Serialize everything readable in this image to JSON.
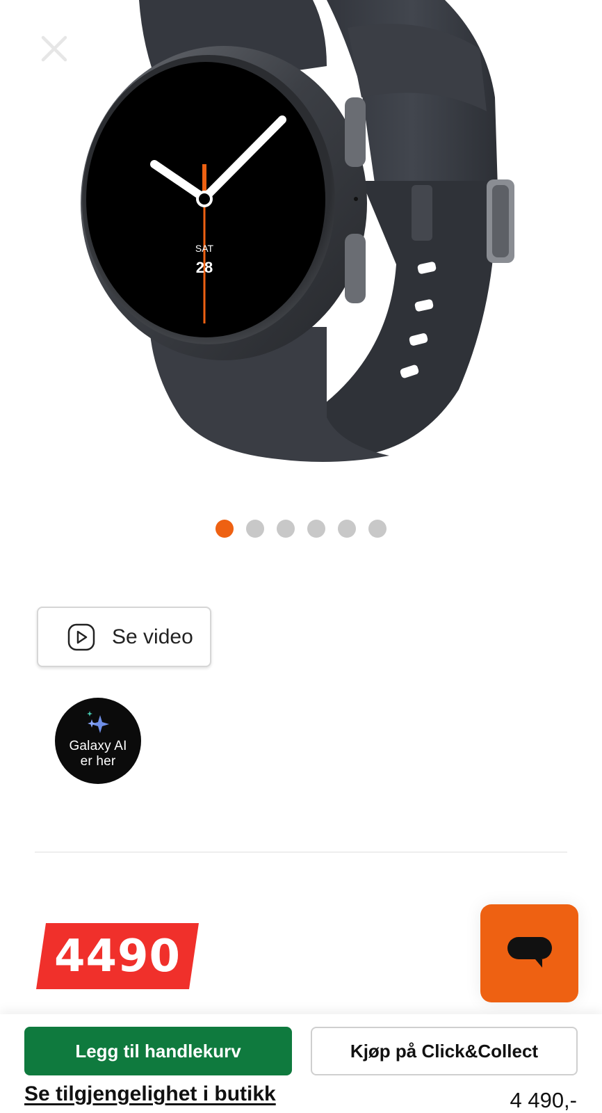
{
  "product": {
    "image_alt": "Samsung Galaxy Watch",
    "watch_face": {
      "day": "SAT",
      "date": "28"
    }
  },
  "carousel": {
    "count": 6,
    "active_index": 0
  },
  "video_button": {
    "label": "Se video"
  },
  "ai_badge": {
    "line1": "Galaxy AI",
    "line2": "er her"
  },
  "price": {
    "tag_value": "4490",
    "display": "4 490,-"
  },
  "actions": {
    "add_to_cart": "Legg til handlekurv",
    "click_collect": "Kjøp på Click&Collect",
    "availability": "Se tilgjengelighet i butikk"
  },
  "colors": {
    "accent_orange": "#ee6112",
    "price_red": "#f0302b",
    "cart_green": "#0f7a3e"
  },
  "icons": [
    "close-icon",
    "play-icon",
    "sparkle-icon",
    "chat-icon"
  ]
}
